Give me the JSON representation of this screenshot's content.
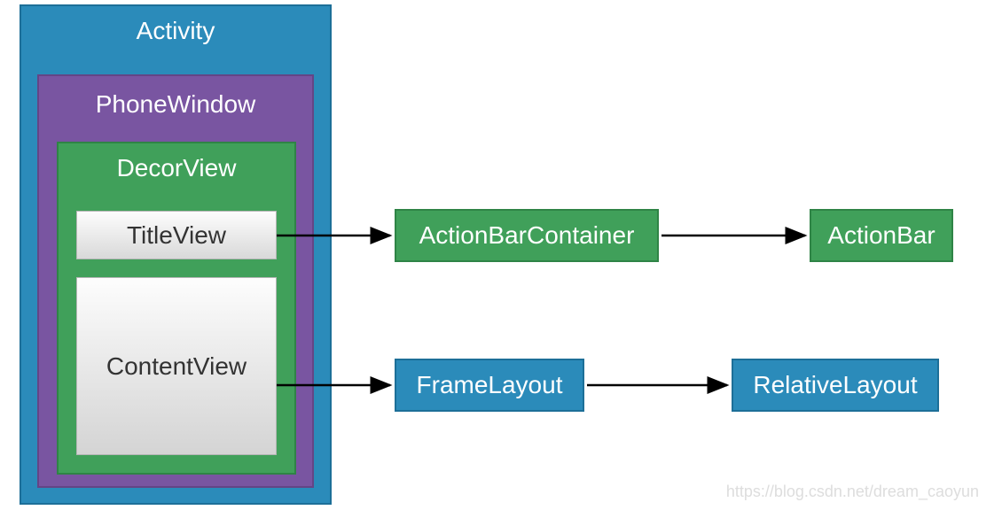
{
  "diagram": {
    "activity": "Activity",
    "phonewindow": "PhoneWindow",
    "decorview": "DecorView",
    "titleview": "TitleView",
    "contentview": "ContentView",
    "actionbarcontainer": "ActionBarContainer",
    "actionbar": "ActionBar",
    "framelayout": "FrameLayout",
    "relativelayout": "RelativeLayout"
  },
  "watermark": "https://blog.csdn.net/dream_caoyun",
  "colors": {
    "blue": "#2b8bba",
    "purple": "#7955a1",
    "green": "#40a05a",
    "grayGradientTop": "#fdfdfd",
    "grayGradientBottom": "#d4d4d4"
  },
  "relations": [
    {
      "from": "TitleView",
      "to": "ActionBarContainer"
    },
    {
      "from": "ActionBarContainer",
      "to": "ActionBar"
    },
    {
      "from": "ContentView",
      "to": "FrameLayout"
    },
    {
      "from": "FrameLayout",
      "to": "RelativeLayout"
    }
  ]
}
